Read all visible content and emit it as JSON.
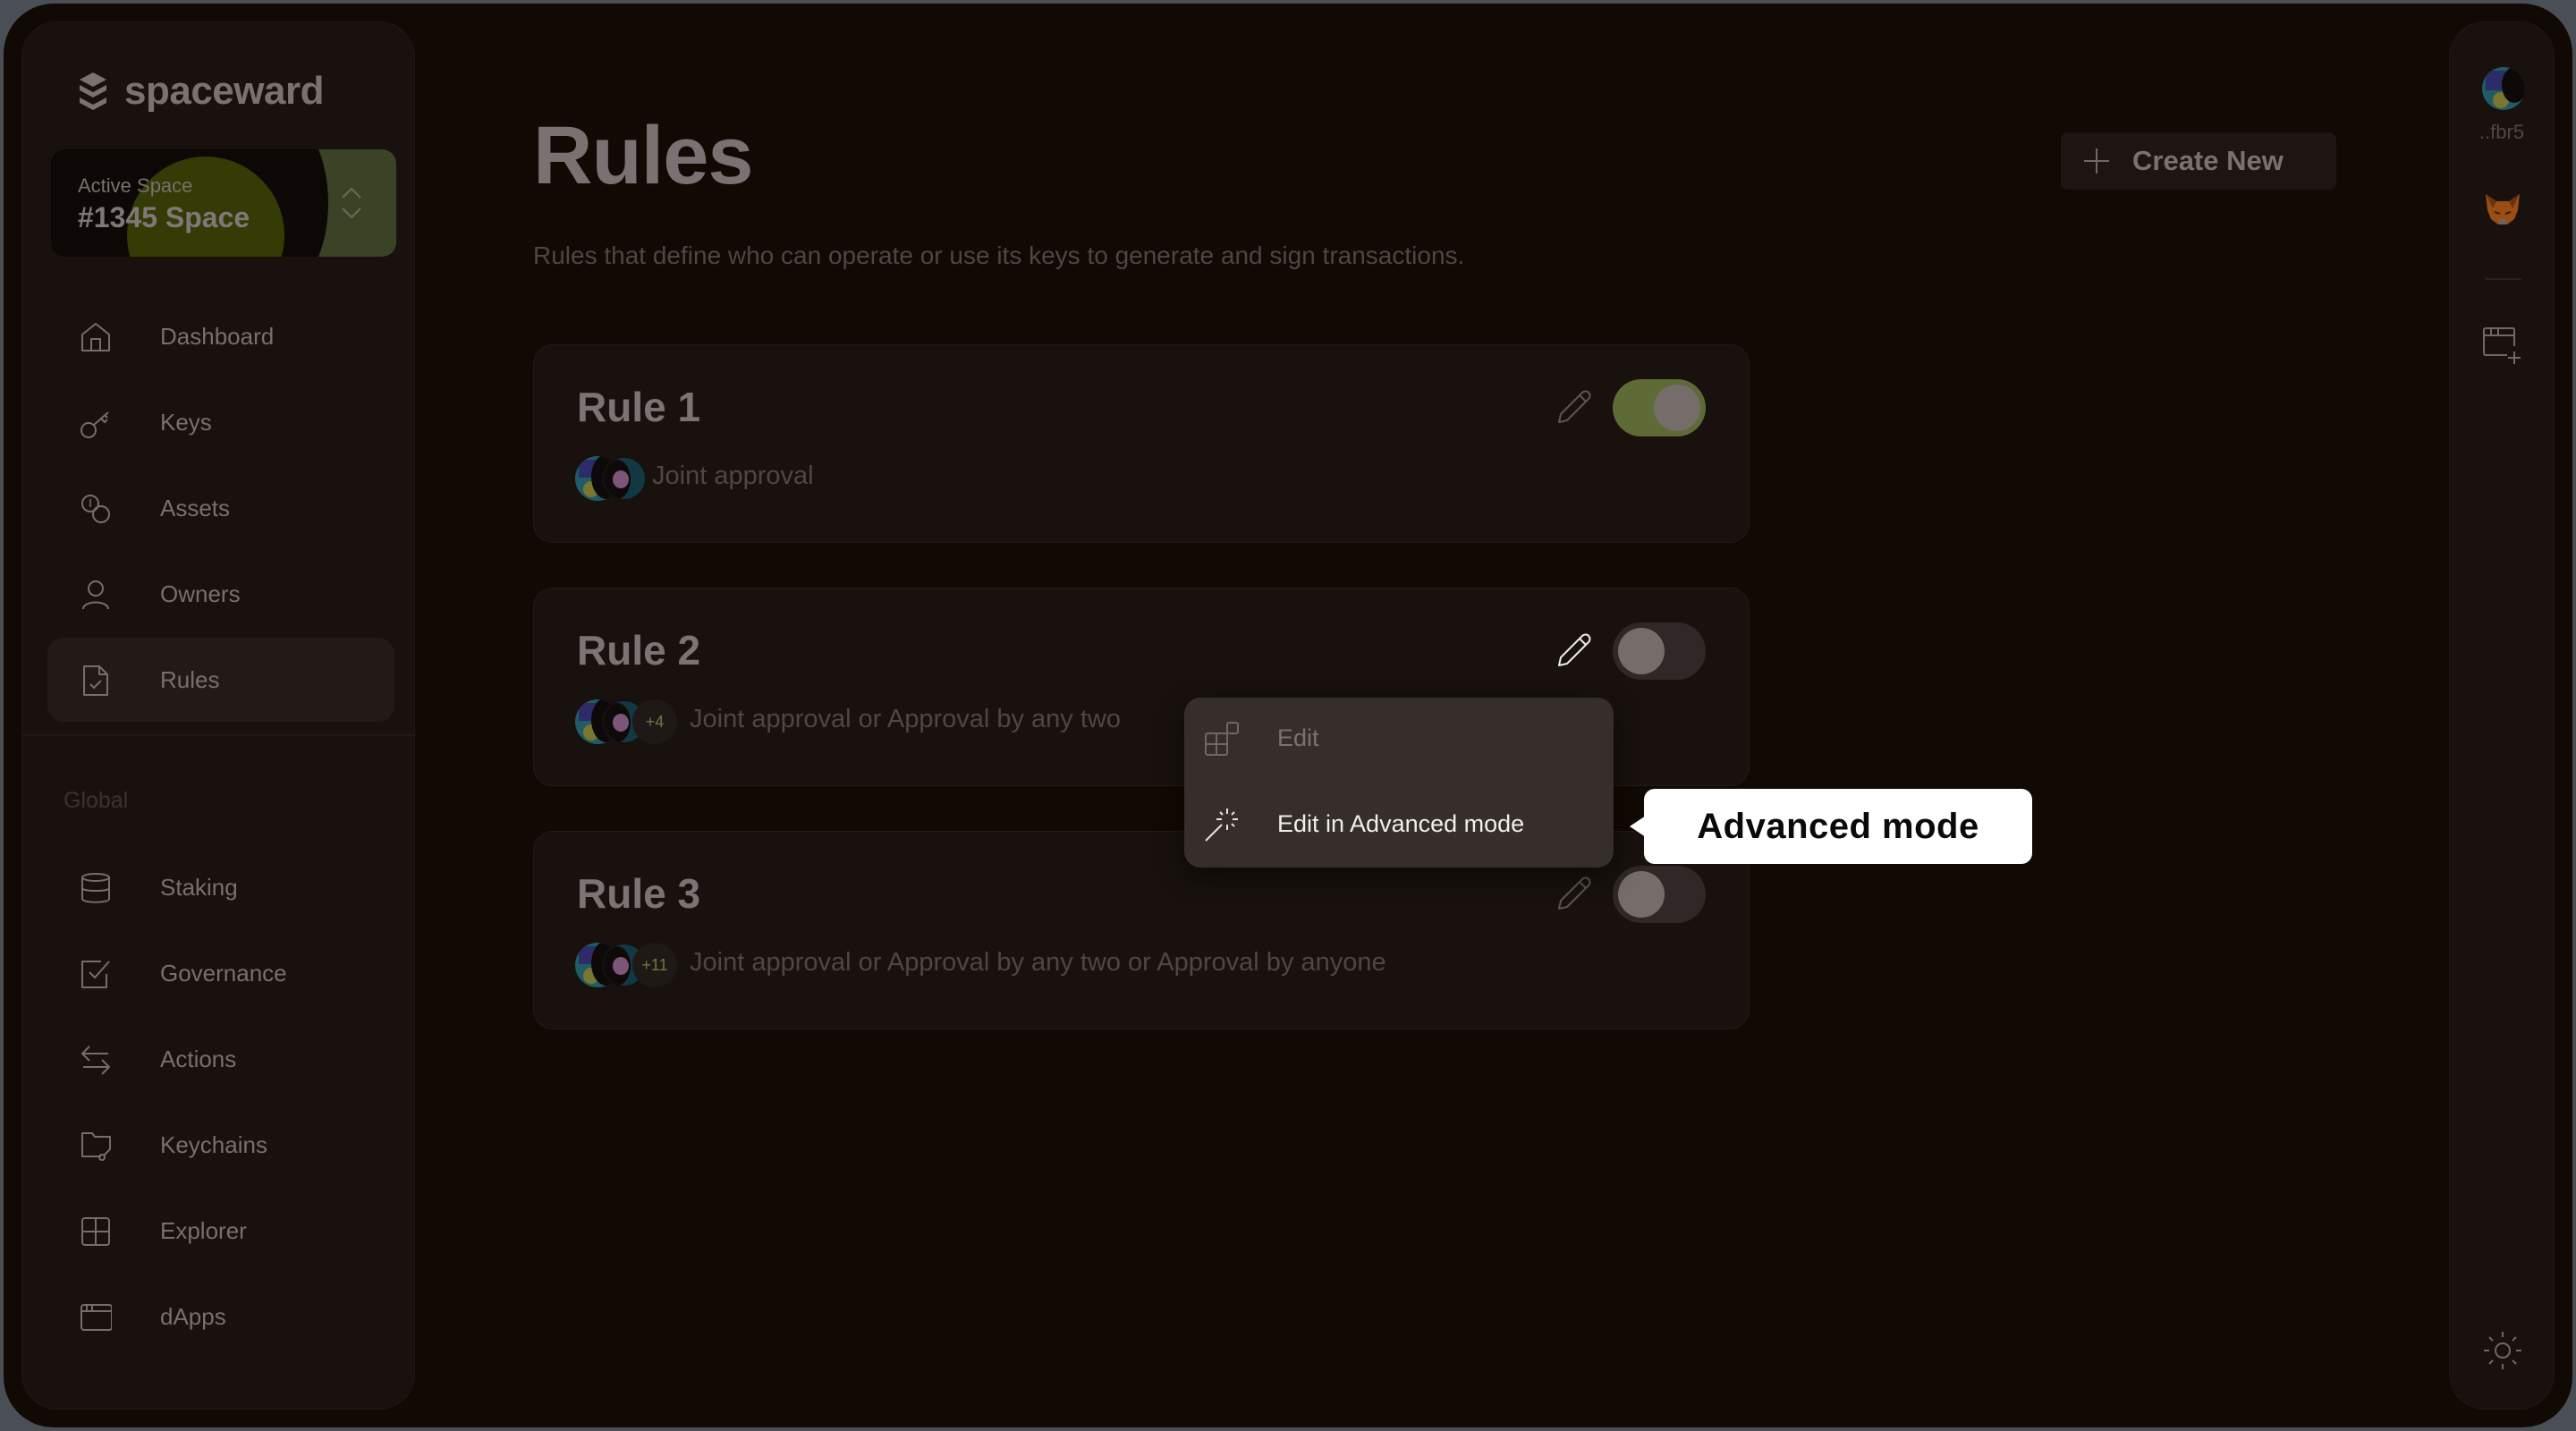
{
  "brand": {
    "name": "spaceward"
  },
  "active_space": {
    "label": "Active Space",
    "name": "#1345 Space"
  },
  "sidebar": {
    "main_items": [
      {
        "label": "Dashboard",
        "icon": "home-icon"
      },
      {
        "label": "Keys",
        "icon": "key-icon"
      },
      {
        "label": "Assets",
        "icon": "coins-icon"
      },
      {
        "label": "Owners",
        "icon": "user-icon"
      },
      {
        "label": "Rules",
        "icon": "document-check-icon",
        "active": true
      }
    ],
    "group_label": "Global",
    "global_items": [
      {
        "label": "Staking",
        "icon": "database-icon"
      },
      {
        "label": "Governance",
        "icon": "checkbox-icon"
      },
      {
        "label": "Actions",
        "icon": "arrows-exchange-icon"
      },
      {
        "label": "Keychains",
        "icon": "folder-key-icon"
      },
      {
        "label": "Explorer",
        "icon": "grid-icon"
      },
      {
        "label": "dApps",
        "icon": "browser-window-icon"
      }
    ]
  },
  "header": {
    "title": "Rules",
    "subtitle": "Rules that define who can operate or use its keys to generate and sign transactions.",
    "create_button": "Create New"
  },
  "rules": [
    {
      "title": "Rule 1",
      "extra_count": "",
      "description": "Joint approval",
      "enabled": true
    },
    {
      "title": "Rule 2",
      "extra_count": "+4",
      "description": "Joint approval or Approval by any two",
      "enabled": false
    },
    {
      "title": "Rule 3",
      "extra_count": "+11",
      "description": "Joint approval or Approval by any two or Approval by anyone",
      "enabled": false
    }
  ],
  "edit_menu": {
    "items": [
      {
        "label": "Edit",
        "icon": "layout-blocks-icon"
      },
      {
        "label": "Edit in Advanced mode",
        "icon": "magic-wand-icon"
      }
    ]
  },
  "tooltip": {
    "text": "Advanced mode"
  },
  "right_rail": {
    "address": "..fbr5",
    "wallet": "metamask-fox-icon"
  },
  "colors": {
    "accent_toggle_on": "#5e6b36",
    "background": "#110903",
    "panel": "#18110d"
  }
}
